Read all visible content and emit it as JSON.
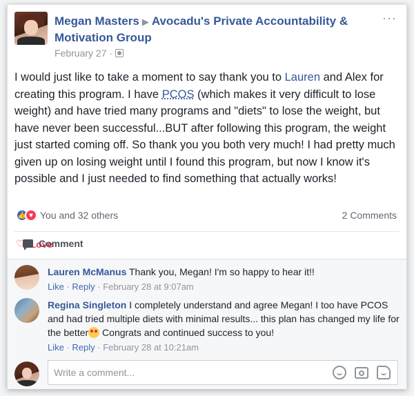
{
  "post": {
    "author": "Megan Masters",
    "separator_icon": "triangle-right-icon",
    "group": "Avocadu's Private Accountability & Motivation Group",
    "date": "February 27 ·",
    "more_icon": "ellipsis-icon",
    "text_before_lauren": "I would just like to take a moment to say thank you to ",
    "lauren_link": "Lauren",
    "text_after_lauren": " and Alex for creating this program. I have ",
    "pcos_link": "PCOS",
    "text_rest": " (which makes it very difficult to lose weight) and have tried many programs and \"diets\" to lose the weight, but have never been successful...BUT after following this program, the weight just started coming off. So thank you you both very much! I had pretty much given up on losing weight until I found this program, but now I know it's possible and I just needed to find something that actually works!"
  },
  "reactions": {
    "count_text": "You and 32 others",
    "comments_count": "2 Comments",
    "like_icon": "thumbs-up-icon",
    "love_icon": "heart-icon"
  },
  "actions": {
    "love_label": "Love",
    "comment_label": "Comment"
  },
  "comments": [
    {
      "name": "Lauren McManus",
      "text": " Thank you, Megan! I'm so happy to hear it!!",
      "like": "Like",
      "reply": "Reply",
      "time": "· February 28 at 9:07am"
    },
    {
      "name": "Regina Singleton",
      "text_before_emoji": " I completely understand and agree Megan! I too have PCOS and had tried multiple diets with minimal results... this plan has changed my life for the better",
      "text_after_emoji": " Congrats and continued success to you!",
      "like": "Like",
      "reply": "Reply",
      "time": "· February 28 at 10:21am"
    }
  ],
  "write_comment": {
    "placeholder": "Write a comment..."
  },
  "colors": {
    "link": "#365899",
    "love": "#f33e58",
    "like": "#4267b2"
  }
}
